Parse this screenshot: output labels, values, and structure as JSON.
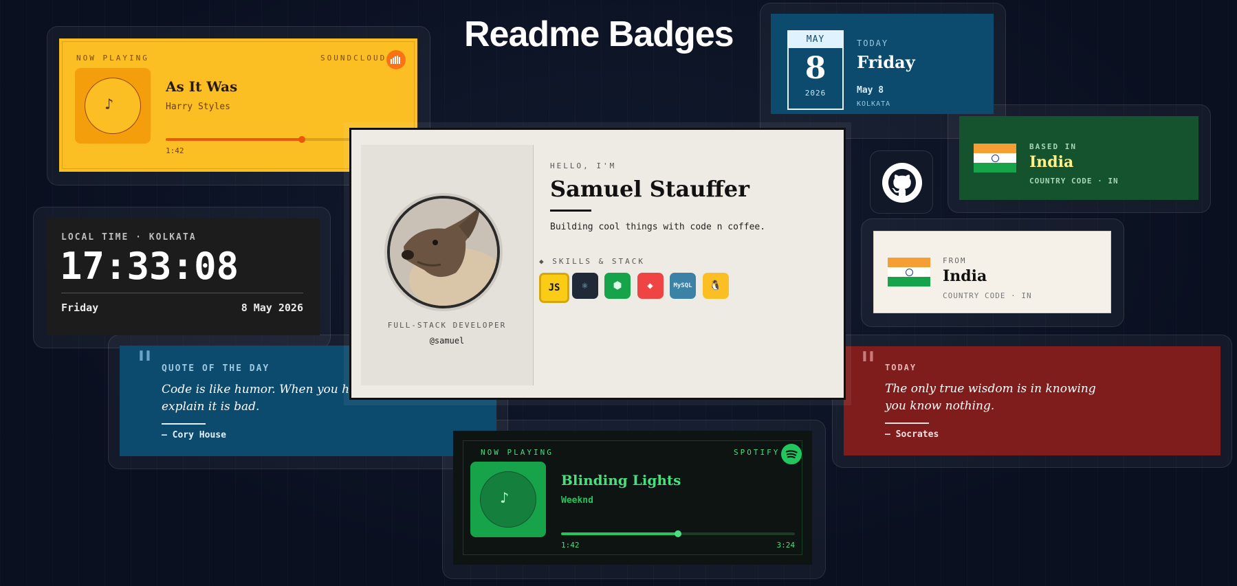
{
  "page_title": "Readme Badges",
  "soundcloud": {
    "now_playing_label": "NOW PLAYING",
    "service": "SOUNDCLOUD",
    "track": "As It Was",
    "artist": "Harry Styles",
    "elapsed": "1:42",
    "progress": 0.6,
    "accent": "#f97316"
  },
  "date_card": {
    "month": "MAY",
    "day": "8",
    "year": "2026",
    "today_label": "TODAY",
    "weekday": "Friday",
    "date_line": "May 8",
    "city": "KOLKATA"
  },
  "profile": {
    "greeting": "HELLO, I'M",
    "name": "Samuel Stauffer",
    "tagline": "Building cool things with code n coffee.",
    "role": "FULL-STACK DEVELOPER",
    "handle": "@samuel",
    "skills_label": "◆ SKILLS & STACK",
    "skills": [
      {
        "icon": "javascript-icon",
        "glyph": "JS",
        "bg": "#facc15",
        "fg": "#111"
      },
      {
        "icon": "react-icon",
        "glyph": "⚛",
        "bg": "#1f2937",
        "fg": "#61dafb"
      },
      {
        "icon": "nodejs-icon",
        "glyph": "⬢",
        "bg": "#16a34a",
        "fg": "#dcfce7"
      },
      {
        "icon": "git-icon",
        "glyph": "◆",
        "bg": "#ef4444",
        "fg": "#fff"
      },
      {
        "icon": "mysql-icon",
        "glyph": "MySQL",
        "bg": "#3b82a6",
        "fg": "#e0f2fe"
      },
      {
        "icon": "linux-icon",
        "glyph": "🐧",
        "bg": "#fbbf24",
        "fg": "#111"
      }
    ]
  },
  "github": {
    "icon": "github-icon"
  },
  "based_in": {
    "label": "BASED IN",
    "country": "India",
    "code_line": "COUNTRY CODE · IN"
  },
  "from_card": {
    "label": "FROM",
    "country": "India",
    "code_line": "COUNTRY CODE · IN"
  },
  "clock": {
    "label": "LOCAL TIME · KOLKATA",
    "time": "17:33:08",
    "weekday": "Friday",
    "date": "8 May 2026"
  },
  "quote_day": {
    "label": "QUOTE OF THE DAY",
    "text": "Code is like humor. When you have to explain it is bad.",
    "author": "— Cory House"
  },
  "quote_today": {
    "label": "TODAY",
    "text": "The only true wisdom is in knowing you know nothing.",
    "author": "— Socrates"
  },
  "spotify": {
    "now_playing_label": "NOW PLAYING",
    "service": "SPOTIFY",
    "track": "Blinding Lights",
    "artist": "Weeknd",
    "elapsed": "1:42",
    "total": "3:24",
    "progress": 0.5,
    "accent": "#22c55e"
  }
}
